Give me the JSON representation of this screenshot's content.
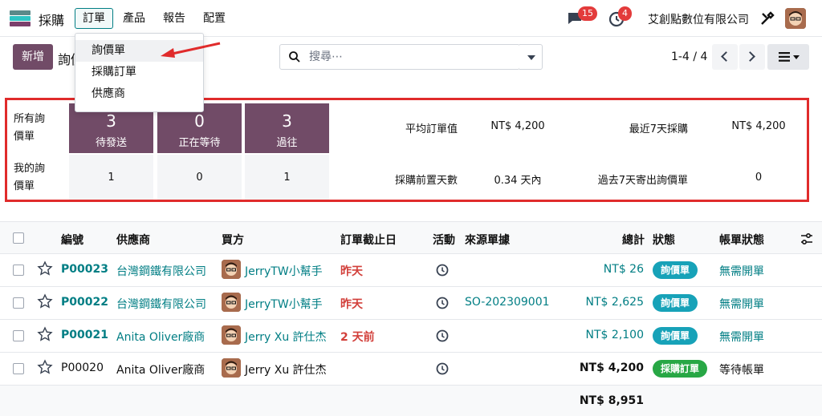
{
  "navbar": {
    "app_name": "採購",
    "menu": [
      "訂單",
      "產品",
      "報告",
      "配置"
    ],
    "messages_count": "15",
    "activities_count": "4",
    "company": "艾創點數位有限公司"
  },
  "dropdown": {
    "items": [
      "詢價單",
      "採購訂單",
      "供應商"
    ]
  },
  "controls": {
    "new_label": "新增",
    "title": "詢價單",
    "search_placeholder": "搜尋⋯",
    "pager": "1-4 / 4"
  },
  "dashboard": {
    "all_rfq_label": "所有詢價單",
    "my_rfq_label": "我的詢價單",
    "tiles": [
      {
        "count": "3",
        "label": "待發送",
        "mine": "1"
      },
      {
        "count": "0",
        "label": "正在等待",
        "mine": "0"
      },
      {
        "count": "3",
        "label": "過往",
        "mine": "1"
      }
    ],
    "stats": [
      {
        "label": "平均訂單值",
        "value": "NT$ 4,200"
      },
      {
        "label": "最近7天採購",
        "value": "NT$ 4,200"
      },
      {
        "label": "採購前置天數",
        "value": "0.34 天內"
      },
      {
        "label": "過去7天寄出詢價單",
        "value": "0"
      }
    ]
  },
  "table": {
    "headers": {
      "ref": "編號",
      "vendor": "供應商",
      "buyer": "買方",
      "deadline": "訂單截止日",
      "activity": "活動",
      "source": "來源單據",
      "total": "總計",
      "status": "狀態",
      "billing": "帳單狀態"
    },
    "rows": [
      {
        "ref": "P00023",
        "vendor": "台灣鋼鐵有限公司",
        "buyer": "JerryTW小幫手",
        "deadline": "昨天",
        "source": "",
        "total": "NT$ 26",
        "status": "詢價單",
        "billing": "無需開單"
      },
      {
        "ref": "P00022",
        "vendor": "台灣鋼鐵有限公司",
        "buyer": "JerryTW小幫手",
        "deadline": "昨天",
        "source": "SO-202309001",
        "total": "NT$ 2,625",
        "status": "詢價單",
        "billing": "無需開單"
      },
      {
        "ref": "P00021",
        "vendor": "Anita Oliver廠商",
        "buyer": "Jerry Xu 許仕杰",
        "deadline": "2 天前",
        "source": "",
        "total": "NT$ 2,100",
        "status": "詢價單",
        "billing": "無需開單"
      },
      {
        "ref": "P00020",
        "vendor": "Anita Oliver廠商",
        "buyer": "Jerry Xu 許仕杰",
        "deadline": "",
        "source": "",
        "total": "NT$ 4,200",
        "status": "採購訂單",
        "billing": "等待帳單"
      }
    ],
    "grand_total": "NT$ 8,951"
  },
  "colors": {
    "brand": "#714b67",
    "link": "#017e84",
    "rfq_pill": "#17a2b8",
    "po_pill": "#28a745",
    "highlight": "#e02b2b"
  }
}
